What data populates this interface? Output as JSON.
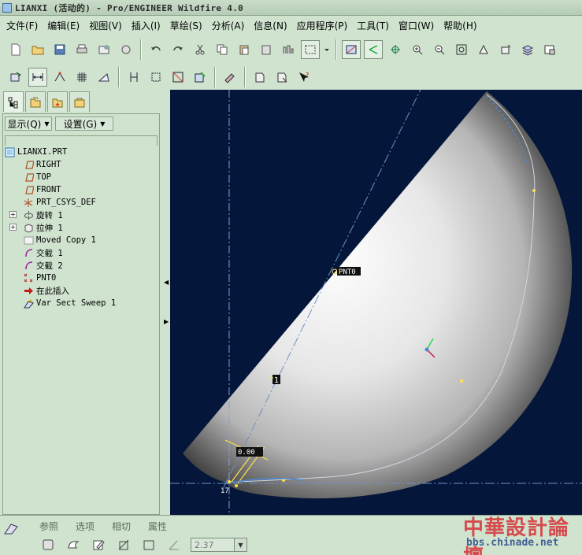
{
  "window": {
    "title": "LIANXI (活动的) - Pro/ENGINEER Wildfire 4.0"
  },
  "menubar": [
    "文件(F)",
    "编辑(E)",
    "视图(V)",
    "插入(I)",
    "草绘(S)",
    "分析(A)",
    "信息(N)",
    "应用程序(P)",
    "工具(T)",
    "窗口(W)",
    "帮助(H)"
  ],
  "left_panel": {
    "show_dropdown": "显示(Q)",
    "settings_dropdown": "设置(G)",
    "tree": [
      {
        "label": "LIANXI.PRT",
        "icon": "part-icon"
      },
      {
        "label": "RIGHT",
        "icon": "datum-plane-icon"
      },
      {
        "label": "TOP",
        "icon": "datum-plane-icon"
      },
      {
        "label": "FRONT",
        "icon": "datum-plane-icon"
      },
      {
        "label": "PRT_CSYS_DEF",
        "icon": "csys-icon"
      },
      {
        "label": "旋转 1",
        "icon": "revolve-icon"
      },
      {
        "label": "拉伸 1",
        "icon": "extrude-icon"
      },
      {
        "label": "Moved Copy 1",
        "icon": "moved-copy-icon"
      },
      {
        "label": "交截 1",
        "icon": "intersect-icon"
      },
      {
        "label": "交截 2",
        "icon": "intersect-icon"
      },
      {
        "label": "PNT0",
        "icon": "datum-point-icon"
      },
      {
        "label": "在此插入",
        "icon": "insert-here-arrow-icon"
      },
      {
        "label": "Var Sect Sweep 1",
        "icon": "var-sect-sweep-icon"
      }
    ]
  },
  "viewport": {
    "point_label": "PNT0",
    "axis_marker": "1",
    "dimension_value": "0.00",
    "corner_label": "17",
    "background": "#04173a"
  },
  "dashboard": {
    "tabs": [
      "参照",
      "选项",
      "相切",
      "属性"
    ],
    "value_input": "2.37"
  },
  "watermark": {
    "cn": "中華設計論壇",
    "url": "bbs.chinade.net"
  }
}
